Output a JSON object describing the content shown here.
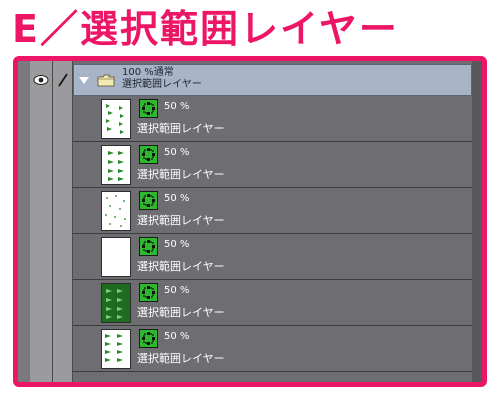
{
  "title": "E／選択範囲レイヤー",
  "folder": {
    "opacity_blend": "100 %通常",
    "name": "選択範囲レイヤー"
  },
  "layers": [
    {
      "opacity": "50 %",
      "name": "選択範囲レイヤー",
      "thumb": "sparse-leaves"
    },
    {
      "opacity": "50 %",
      "name": "選択範囲レイヤー",
      "thumb": "leaves-columns"
    },
    {
      "opacity": "50 %",
      "name": "選択範囲レイヤー",
      "thumb": "dots"
    },
    {
      "opacity": "50 %",
      "name": "選択範囲レイヤー",
      "thumb": "blank"
    },
    {
      "opacity": "50 %",
      "name": "選択範囲レイヤー",
      "thumb": "dense-green"
    },
    {
      "opacity": "50 %",
      "name": "選択範囲レイヤー",
      "thumb": "leaves-grid"
    }
  ],
  "colors": {
    "accent": "#ec1566",
    "panel": "#6e6e72",
    "folder_highlight": "#a7b4c7",
    "mask_green": "#2fb82f"
  }
}
